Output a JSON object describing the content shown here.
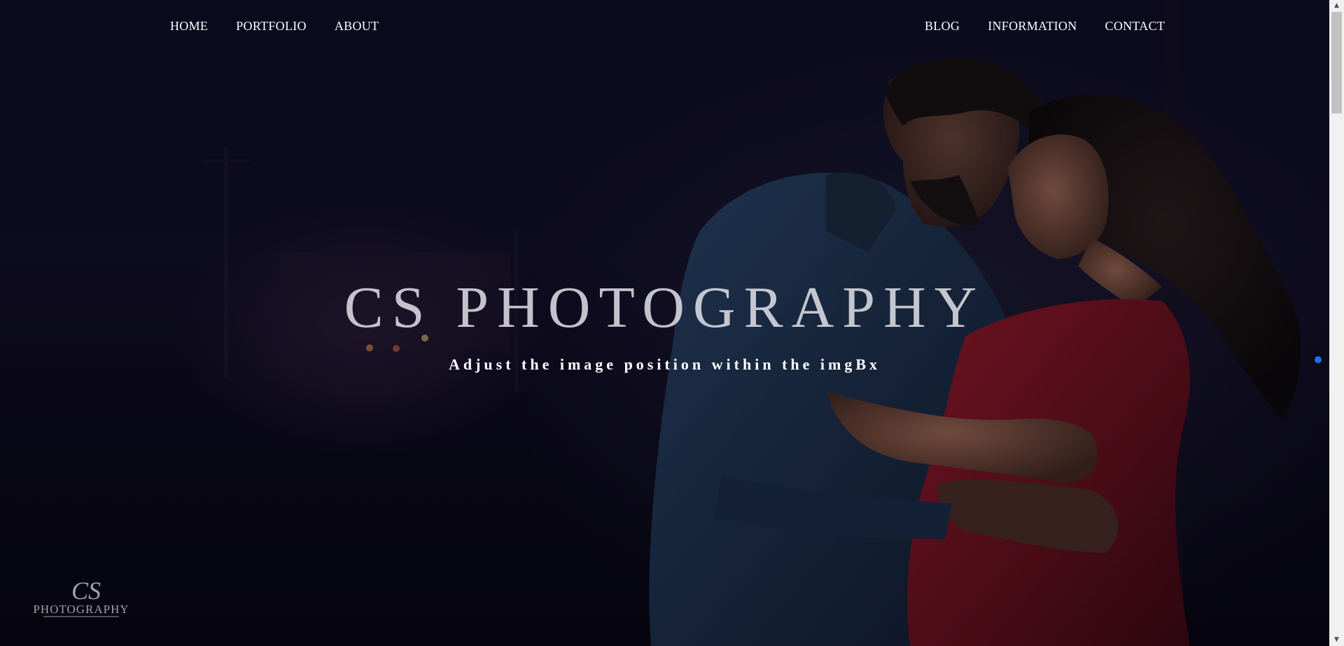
{
  "nav": {
    "left": [
      "HOME",
      "PORTFOLIO",
      "ABOUT"
    ],
    "right": [
      "BLOG",
      "INFORMATION",
      "CONTACT"
    ]
  },
  "hero": {
    "title": "CS PHOTOGRAPHY",
    "subtitle": "Adjust the image position within the imgBx",
    "image_alt": "Couple portrait at night"
  },
  "logo": {
    "monogram": "CS",
    "wordmark": "PHOTOGRAPHY"
  },
  "colors": {
    "nav_text": "#ffffff",
    "title_text": "#dcdce4",
    "accent_dot": "#1a73e8",
    "dress": "#7a0f1c",
    "suit": "#1f3550"
  },
  "icons": {
    "scroll_up": "scroll-up-arrow-icon",
    "scroll_down": "scroll-down-arrow-icon",
    "indicator": "slide-indicator-dot-icon"
  }
}
